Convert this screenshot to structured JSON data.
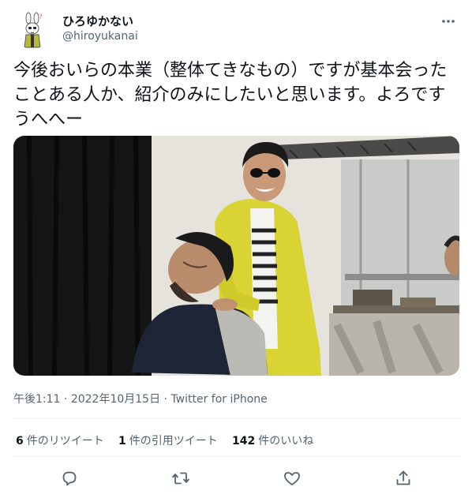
{
  "author": {
    "display_name": "ひろゆかない",
    "handle": "@hiroyukanai",
    "avatar": "rabbit-character-avatar"
  },
  "tweet": {
    "text": "今後おいらの本業（整体てきなもの）ですが基本会ったことある人か、紹介のみにしたいと思います。よろですうへへー"
  },
  "photo": {
    "description_icon": "photo"
  },
  "meta": {
    "time": "午後1:11",
    "sep1": " · ",
    "date": "2022年10月15日",
    "sep2": " · ",
    "source": "Twitter for iPhone"
  },
  "stats": {
    "retweets_count": "6",
    "retweets_label": "件のリツイート",
    "quotes_count": "1",
    "quotes_label": "件の引用ツイート",
    "likes_count": "142",
    "likes_label": "件のいいね"
  },
  "icons": {
    "more": "more-icon",
    "reply": "reply-icon",
    "retweet": "retweet-icon",
    "like": "heart-icon",
    "share": "share-icon"
  },
  "colors": {
    "text": "#0f1419",
    "secondary": "#536471",
    "divider": "#eff3f4"
  }
}
